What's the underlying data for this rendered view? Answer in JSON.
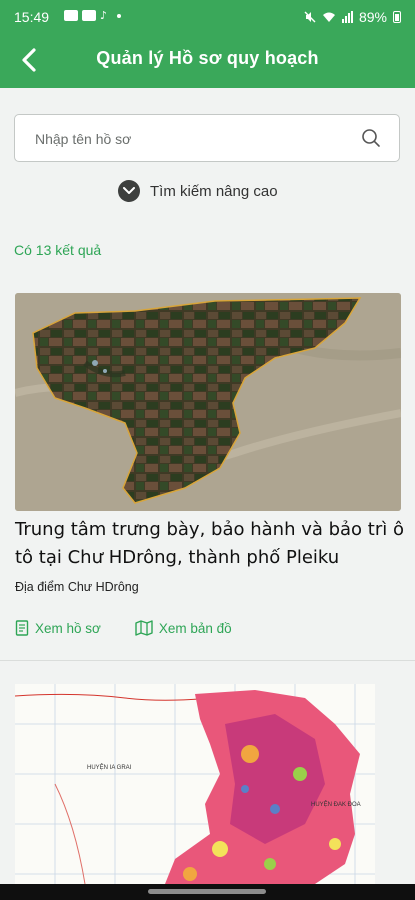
{
  "status_bar": {
    "time": "15:49",
    "notif_icon": "tiktok-icon",
    "battery": "89%"
  },
  "app_bar": {
    "title": "Quản lý Hồ sơ quy hoạch",
    "back_icon": "back-arrow-icon"
  },
  "search": {
    "placeholder": "Nhập tên hồ sơ",
    "value": ""
  },
  "advanced_search": {
    "label": "Tìm kiếm nâng cao"
  },
  "results": {
    "count_text": "Có 13 kết quả"
  },
  "cards": [
    {
      "title": "Trung tâm trưng bày, bảo hành và bảo trì ô tô tại  Chư HDrông, thành phố Pleiku",
      "location_label": "Địa điểm",
      "location_value": "Chư HDrông",
      "view_profile": "Xem hồ sơ",
      "view_map": "Xem bản đồ"
    },
    {
      "map_label_left": "HUYỆN IA GRAI",
      "map_label_right": "HUYỆN ĐAK ĐOA"
    }
  ],
  "colors": {
    "primary": "#3aa85a",
    "link": "#2ea556"
  }
}
